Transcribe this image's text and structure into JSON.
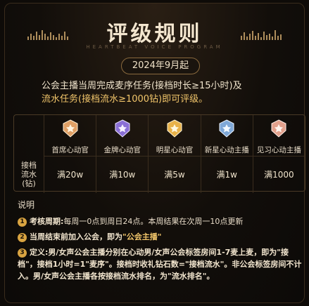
{
  "header": {
    "title": "评级规则",
    "subtitle": "HEARTBEAT VOICE PROGRAM",
    "date": "2024年9月起"
  },
  "intro": {
    "line1": "公会主播当周完成麦序任务(接档时长≥15小时)及",
    "line2": "流水任务(接档流水≥1000钻)即可评级。"
  },
  "table": {
    "row_label": [
      "接档",
      "流水",
      "(钻)"
    ],
    "tiers": [
      {
        "name": "首席心动官",
        "value": "满20w",
        "icon": "orange-medal-icon",
        "color": "#e0a066"
      },
      {
        "name": "金牌心动官",
        "value": "满10w",
        "icon": "purple-medal-icon",
        "color": "#8a6fd6"
      },
      {
        "name": "明星心动官",
        "value": "满5w",
        "icon": "gold-medal-icon",
        "color": "#e8b24a"
      },
      {
        "name": "新星心动主播",
        "value": "满1w",
        "icon": "blue-medal-icon",
        "color": "#7fa8d8"
      },
      {
        "name": "见习心动主播",
        "value": "满1000",
        "icon": "pink-medal-icon",
        "color": "#e2a08c"
      }
    ]
  },
  "notes": {
    "title": "说明",
    "items": [
      {
        "num": "1",
        "head": "考核周期:",
        "text": "每周一0点到周日24点。本周结果在次周一10点更新"
      },
      {
        "num": "2",
        "head": "当周结束前加入公会，即为",
        "quote": "\"公会主播\""
      },
      {
        "num": "3",
        "text": "定义:男/女声公会主播分别在心动男/女声公会标签房间1-7麦上麦，即为\"接档\"，接档1小时=1\"麦序\"。接档时收礼钻石数=\"接档流水\"。非公会标签房间不计入。男/女声公会主播各按接档流水排名，为\"流水排名\"。"
      }
    ]
  }
}
